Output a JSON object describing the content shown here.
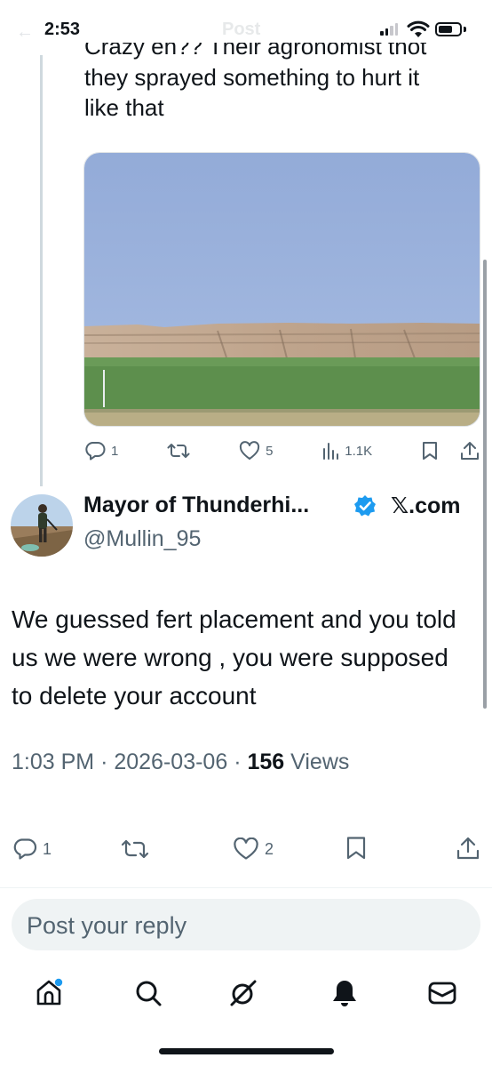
{
  "status_bar": {
    "time": "2:53",
    "title_behind": "Post"
  },
  "parent_tweet": {
    "text_clipped": "Crazy eh?? Their agronomist thot",
    "text_line_2": "they sprayed something to hurt it",
    "text_line_3": "like that",
    "actions": {
      "replies": "1",
      "reposts": "",
      "likes": "5",
      "views": "1.1K"
    }
  },
  "tweet": {
    "display_name": "Mayor of Thunderhi...",
    "affiliation": "𝕏.com",
    "handle": "@Mullin_95",
    "text": "We guessed fert placement and you told us we were wrong , you were supposed to delete your account",
    "time": "1:03 PM",
    "date": "2026-03-06",
    "views_count": "156",
    "views_label": "Views",
    "actions": {
      "replies": "1",
      "likes": "2"
    }
  },
  "reply": {
    "placeholder": "Post your reply"
  },
  "tab_bar": {
    "items": [
      "home-icon",
      "search-icon",
      "grok-icon",
      "notifications-icon",
      "messages-icon"
    ]
  },
  "colors": {
    "text": "#0f1419",
    "secondary": "#536471",
    "verified": "#1d9bf0",
    "reply_bg": "#eff3f4",
    "notification_dot": "#1d9bf0"
  }
}
